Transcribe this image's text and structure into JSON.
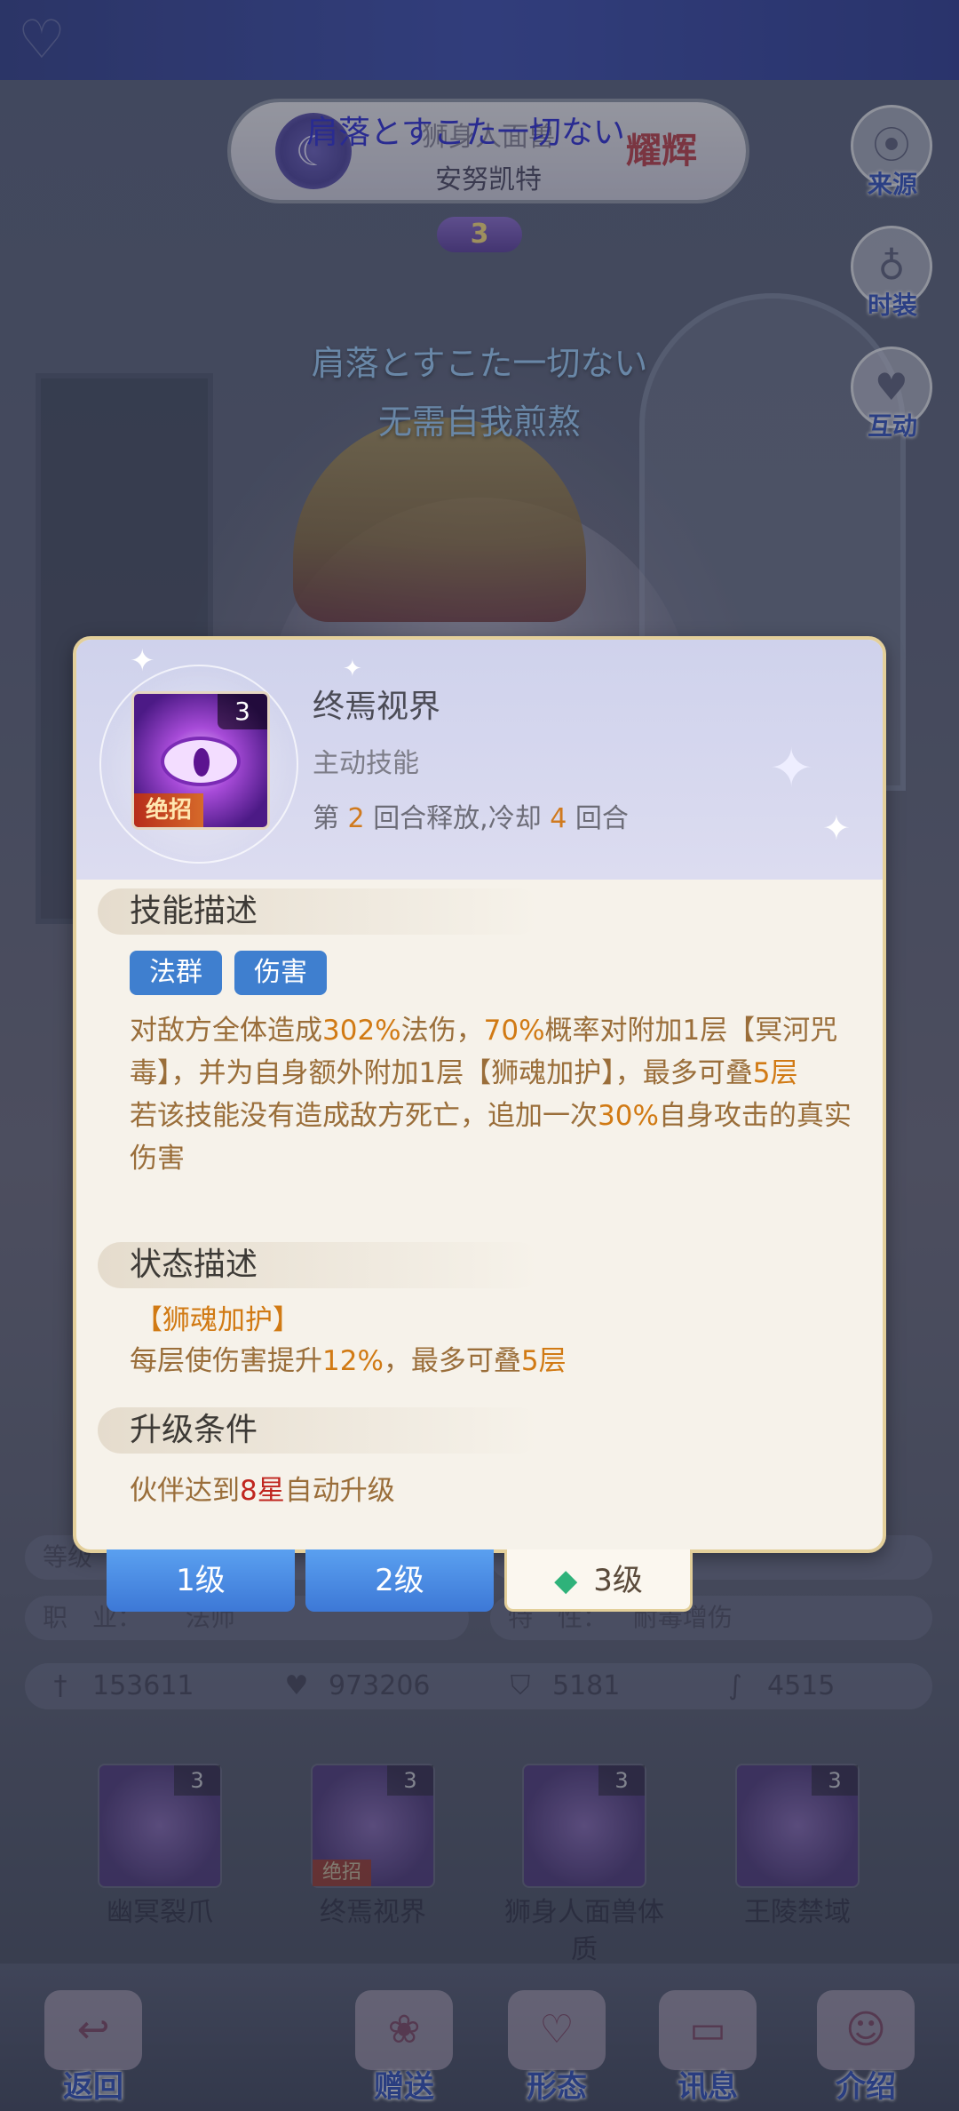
{
  "hero": {
    "name": "狮身人面兽",
    "sub_name": "安努凯特",
    "rank_badge": "耀辉",
    "stars": "3",
    "overlay_lyric": "肩落とすこた一切ない"
  },
  "side_buttons": [
    {
      "icon": "location-pin-icon",
      "label": "来源"
    },
    {
      "icon": "bag-icon",
      "label": "时装"
    },
    {
      "icon": "heart-icon",
      "label": "互动"
    }
  ],
  "lyrics": {
    "line1": "肩落とすこた一切ない",
    "line2": "无需自我煎熬"
  },
  "skill_popup": {
    "icon_level": "3",
    "icon_badge": "绝招",
    "title": "终焉视界",
    "type": "主动技能",
    "cd_prefix": "第",
    "cd_round": "2",
    "cd_mid": "回合释放,冷却",
    "cd_value": "4",
    "cd_suffix": "回合",
    "section_desc": "技能描述",
    "tags": [
      "法群",
      "伤害"
    ],
    "desc_line1_a": "对敌方全体造成",
    "desc_line1_pct": "302%",
    "desc_line1_b": "法伤，",
    "desc_line1_prob": "70%",
    "desc_line1_c": "概率对附加1层【冥河咒毒】，并为自身额外附加1层【狮魂加护】，最多可叠",
    "desc_line1_stack": "5层",
    "desc_line2_a": "若该技能没有造成敌方死亡，追加一次",
    "desc_line2_pct": "30%",
    "desc_line2_b": "自身攻击的真实伤害",
    "section_status": "状态描述",
    "status_name": "【狮魂加护】",
    "status_a": "每层使伤害提升",
    "status_pct": "12%",
    "status_b": "，最多可叠",
    "status_stack": "5层",
    "section_upgrade": "升级条件",
    "upgrade_a": "伙伴达到",
    "upgrade_star": "8星",
    "upgrade_b": "自动升级"
  },
  "level_tabs": [
    "1级",
    "2级",
    "3级"
  ],
  "info": {
    "level_label": "等级",
    "class_label": "职　业：",
    "class_value": "法师",
    "trait_label": "特　性：",
    "trait_value": "耐毒增伤"
  },
  "stats": [
    {
      "icon": "attack-icon",
      "value": "153611"
    },
    {
      "icon": "hp-heart-icon",
      "value": "973206"
    },
    {
      "icon": "defense-shield-icon",
      "value": "5181"
    },
    {
      "icon": "speed-boot-icon",
      "value": "4515"
    }
  ],
  "skills": [
    {
      "name": "幽冥裂爪",
      "level": "3"
    },
    {
      "name": "终焉视界",
      "level": "3",
      "badge": "绝招"
    },
    {
      "name": "狮身人面兽体质",
      "level": "3"
    },
    {
      "name": "王陵禁域",
      "level": "3"
    }
  ],
  "nav": [
    {
      "icon": "back-arrow-icon",
      "label": "返回"
    },
    {
      "icon": "gift-icon",
      "label": "赠送"
    },
    {
      "icon": "outfit-icon",
      "label": "形态"
    },
    {
      "icon": "book-icon",
      "label": "讯息"
    },
    {
      "icon": "portrait-icon",
      "label": "介绍"
    }
  ]
}
